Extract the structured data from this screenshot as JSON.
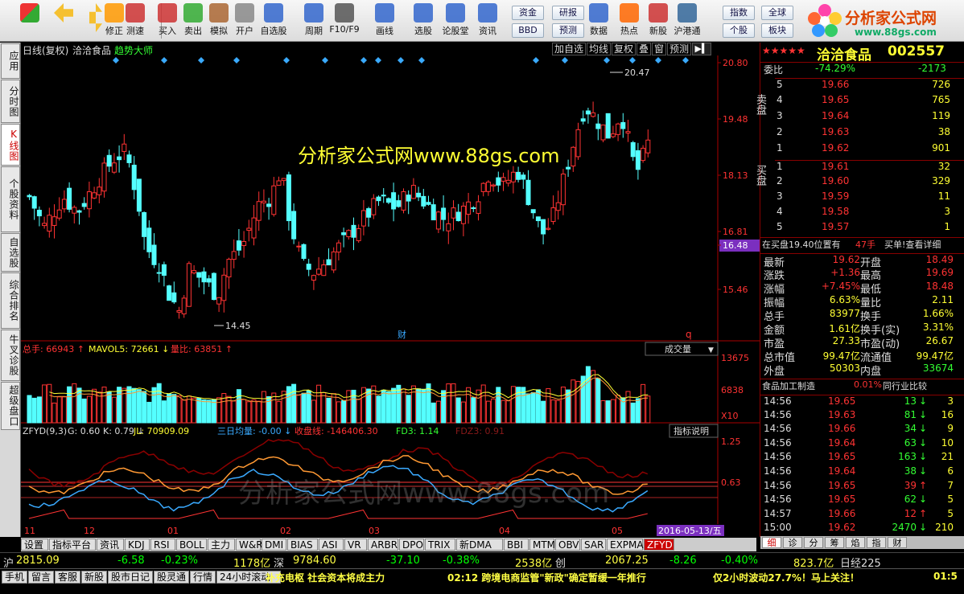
{
  "toolbar": {
    "items": [
      "修正",
      "测速",
      "买入",
      "卖出",
      "模拟",
      "开户",
      "自选股",
      "周期",
      "F10/F9",
      "画线",
      "选股",
      "论股堂",
      "资讯",
      "数据",
      "热点",
      "新股",
      "沪港通"
    ],
    "small": [
      "资金",
      "BBD",
      "研报",
      "预测",
      "指数",
      "个股",
      "全球",
      "板块"
    ]
  },
  "logo": {
    "title": "分析家公式网",
    "url": "www.88gs.com"
  },
  "left_tabs": [
    "应用",
    "分时图",
    "K线图",
    "个股资料",
    "自选股",
    "综合排名",
    "牛叉诊股",
    "超级盘口"
  ],
  "chart": {
    "period": "日线(复权)",
    "name": "洽洽食品",
    "indicator_name": "趋势大师",
    "buttons": [
      "加自选",
      "均线",
      "复权",
      "叠",
      "窗",
      "预测"
    ],
    "price_axis": [
      "20.80",
      "19.48",
      "18.13",
      "16.81",
      "16.48",
      "15.46"
    ],
    "high_label": "20.47",
    "low_label": "14.45",
    "watermark": "分析家公式网www.88gs.com",
    "fin_mark": "财",
    "q_mark": "q",
    "vol_header": {
      "total": "总手: 66943",
      "mavol": "MAVOL5: 72661",
      "ratio": "量比: 63851"
    },
    "vol_select": "成交量",
    "vol_axis": [
      "13675",
      "6838",
      "X10"
    ],
    "ind_header": [
      "ZFYD(9,3)",
      "G: 0.60",
      "K: 0.79",
      "JL: 70909.09",
      "三日均量: -0.00",
      "收盘线: -146406.30",
      "FD3: 1.14",
      "FDZ3: 0.91"
    ],
    "ind_btn": "指标说明",
    "ind_axis": [
      "1.25",
      "0.63"
    ],
    "x_axis": [
      "11",
      "12",
      "01",
      "02",
      "03",
      "04",
      "05"
    ],
    "date_label": "2016-05-13/五"
  },
  "chart_data": {
    "type": "candlestick",
    "title": "洽洽食品 日线(复权)",
    "ylim": [
      14.45,
      20.8
    ],
    "last_close": 19.62,
    "high": 20.47,
    "low": 14.45
  },
  "quote": {
    "stars": "★★★★★",
    "name": "洽洽食品",
    "code": "002557",
    "weibi_label": "委比",
    "weibi": "-74.29%",
    "weicha": "-2173",
    "sell": [
      [
        "5",
        "19.66",
        "726"
      ],
      [
        "4",
        "19.65",
        "765"
      ],
      [
        "3",
        "19.64",
        "119"
      ],
      [
        "2",
        "19.63",
        "38"
      ],
      [
        "1",
        "19.62",
        "901"
      ]
    ],
    "buy": [
      [
        "1",
        "19.61",
        "32"
      ],
      [
        "2",
        "19.60",
        "329"
      ],
      [
        "3",
        "19.59",
        "11"
      ],
      [
        "4",
        "19.58",
        "3"
      ],
      [
        "5",
        "19.57",
        "1"
      ]
    ],
    "sell_label": "卖盘",
    "buy_label": "买盘",
    "pos_text": "在买盘19.40位置有",
    "pos_val": "47手",
    "pos_act": "买单!查看详细",
    "stats": [
      [
        "最新",
        "19.62",
        "开盘",
        "18.49"
      ],
      [
        "涨跌",
        "+1.36",
        "最高",
        "19.69"
      ],
      [
        "涨幅",
        "+7.45%",
        "最低",
        "18.48"
      ],
      [
        "振幅",
        "6.63%",
        "量比",
        "2.11"
      ],
      [
        "总手",
        "83977",
        "换手",
        "1.66%"
      ],
      [
        "金额",
        "1.61亿",
        "换手(实)",
        "3.31%"
      ],
      [
        "市盈",
        "27.33",
        "市盈(动)",
        "26.67"
      ],
      [
        "总市值",
        "99.47亿",
        "流通值",
        "99.47亿"
      ],
      [
        "外盘",
        "50303",
        "内盘",
        "33674"
      ]
    ],
    "industry": "食品加工制造",
    "industry_pct": "0.01%",
    "industry_btn": "同行业比较",
    "ticks": [
      [
        "14:56",
        "19.65",
        "13",
        "3"
      ],
      [
        "14:56",
        "19.63",
        "81",
        "16"
      ],
      [
        "14:56",
        "19.66",
        "34",
        "9"
      ],
      [
        "14:56",
        "19.64",
        "63",
        "10"
      ],
      [
        "14:56",
        "19.65",
        "163",
        "21"
      ],
      [
        "14:56",
        "19.64",
        "38",
        "6"
      ],
      [
        "14:56",
        "19.65",
        "39",
        "7"
      ],
      [
        "14:56",
        "19.65",
        "62",
        "5"
      ],
      [
        "14:57",
        "19.66",
        "12",
        "5"
      ],
      [
        "15:00",
        "19.62",
        "2470",
        "210"
      ]
    ],
    "tick_dirs": [
      "d",
      "d",
      "d",
      "d",
      "d",
      "d",
      "u",
      "d",
      "u",
      "d"
    ],
    "tabs": [
      "细",
      "诊",
      "分",
      "筹",
      "焰",
      "指",
      "财"
    ]
  },
  "bottom_tabs": [
    "设置",
    "指标平台",
    "资讯",
    "KDJ",
    "RSI",
    "BOLL",
    "主力",
    "W&R",
    "DMI",
    "BIAS",
    "ASI",
    "VR",
    "ARBR",
    "DPO",
    "TRIX",
    "新DMA",
    "BBI",
    "MTM",
    "OBV",
    "SAR",
    "EXPMA",
    "ZFYD"
  ],
  "index": {
    "sh_label": "沪",
    "sh": "2815.09",
    "sh_chg": "-6.58",
    "sh_pct": "-0.23%",
    "sh_amt": "1178亿",
    "sz_label": "深",
    "sz": "9784.60",
    "sz_chg": "-37.10",
    "sz_pct": "-0.38%",
    "sz_amt": "2538亿",
    "cy_label": "创",
    "cy": "2067.25",
    "cy_chg": "-8.26",
    "cy_pct": "-0.40%",
    "cy_amt": "823.7亿",
    "rj": "日经225"
  },
  "status": {
    "tabs": [
      "手机",
      "留言",
      "客服",
      "新股",
      "股市日记",
      "股灵通",
      "行情",
      "24小时滚动"
    ],
    "news1": "补充电枢 社会资本将成主力",
    "news2": "02:12 跨境电商监管\"新政\"确定暂缓一年推行",
    "news3": "仅2小时波动27.7%！马上关注！",
    "clock": "01:5"
  }
}
